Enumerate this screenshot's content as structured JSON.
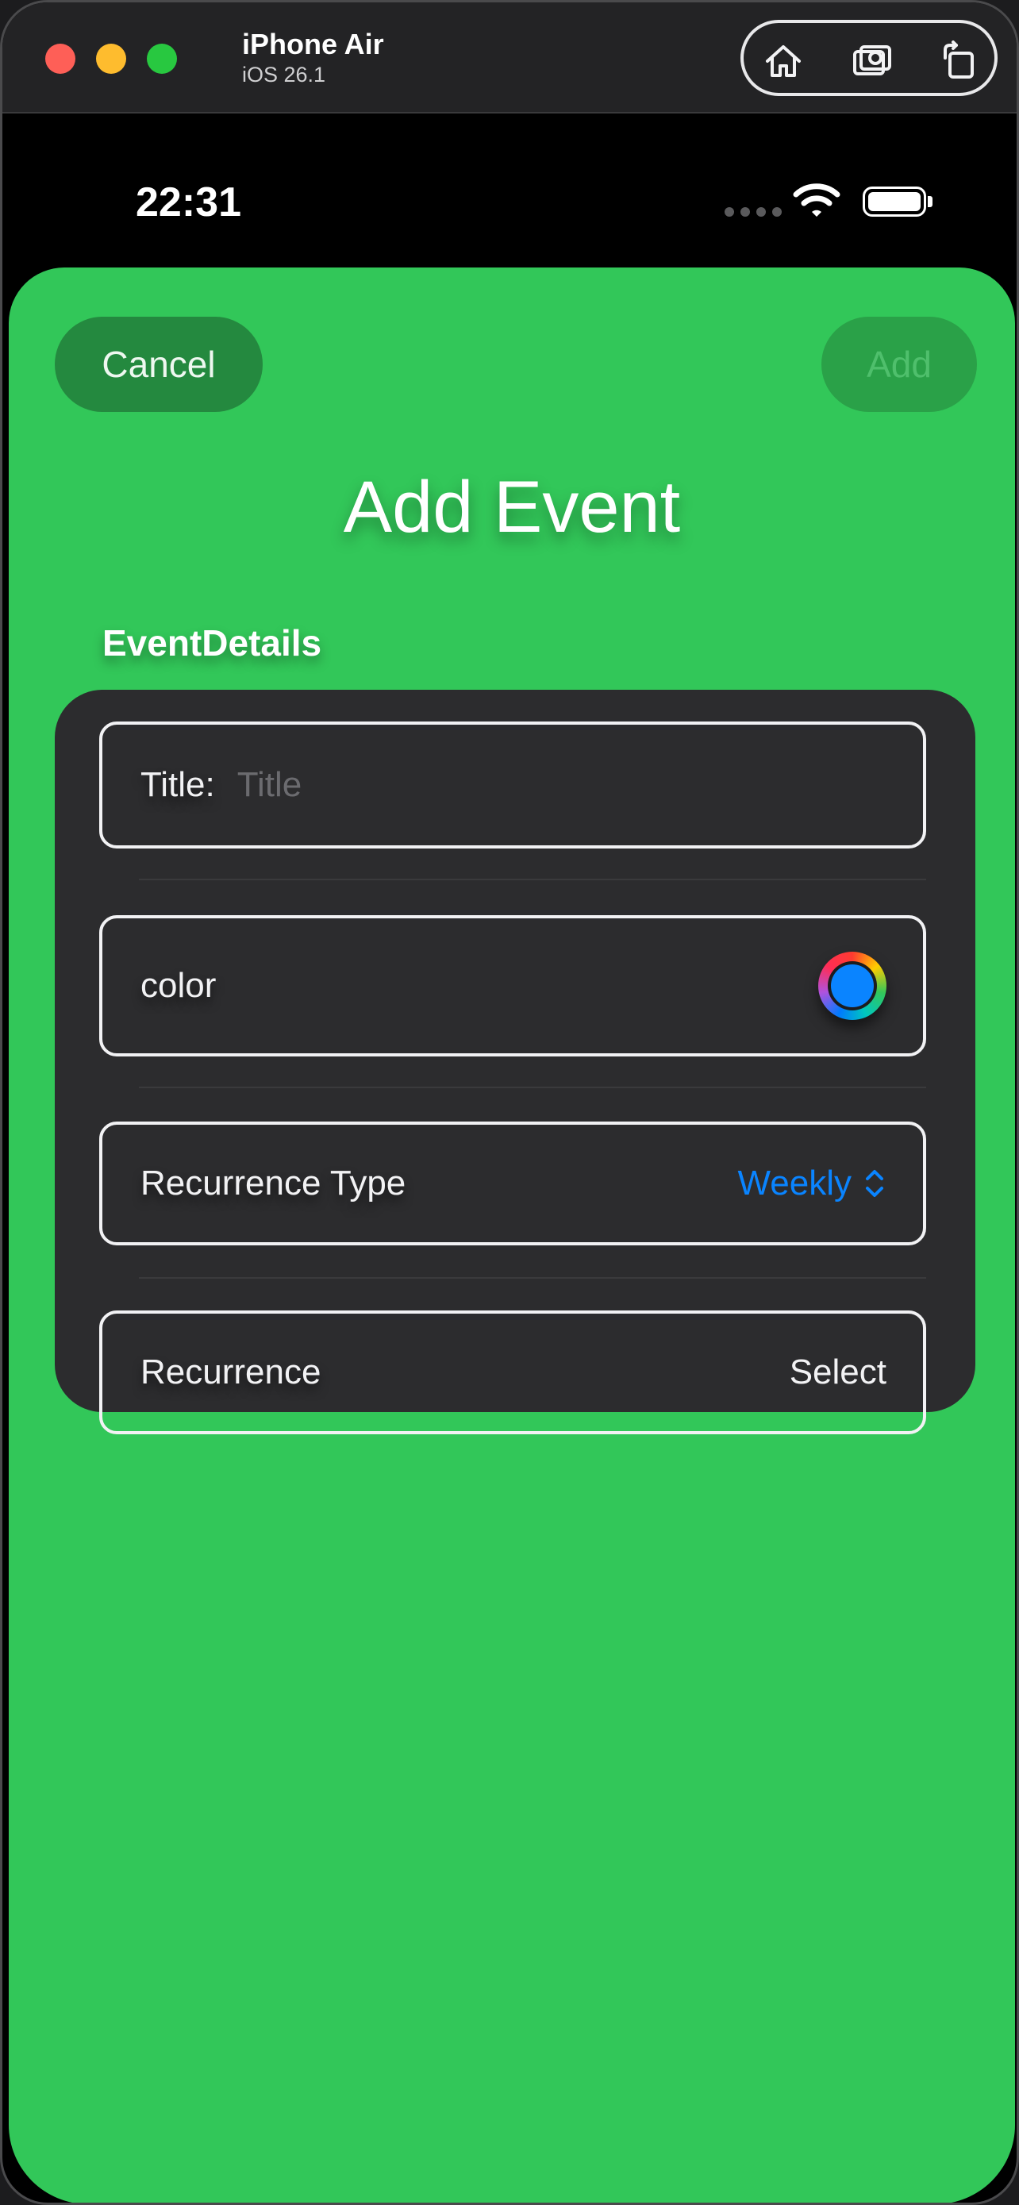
{
  "simulator": {
    "device_name": "iPhone Air",
    "os_version": "iOS 26.1",
    "tools": [
      {
        "icon": "home-icon"
      },
      {
        "icon": "screenshot-icon"
      },
      {
        "icon": "rotate-icon"
      }
    ]
  },
  "status_bar": {
    "time": "22:31"
  },
  "nav": {
    "cancel_label": "Cancel",
    "add_label": "Add"
  },
  "sheet": {
    "title": "Add Event",
    "section_header": "EventDetails",
    "background_color": "#32c759"
  },
  "form": {
    "title_label": "Title:",
    "title_placeholder": "Title",
    "title_value": "",
    "color_label": "color",
    "color_value": "#0a84ff",
    "recurrence_type_label": "Recurrence Type",
    "recurrence_type_value": "Weekly",
    "recurrence_label": "Recurrence",
    "recurrence_value": "Select"
  }
}
